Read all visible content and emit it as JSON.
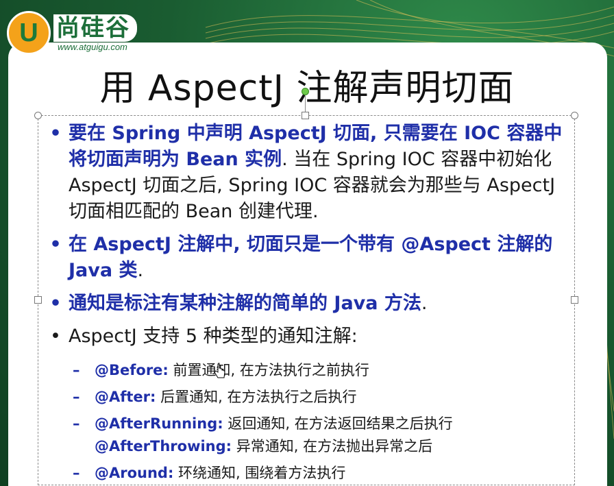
{
  "logo": {
    "badge_letter": "U",
    "name": "尚硅谷",
    "url": "www.atguigu.com",
    "brand_color": "#1d6f3a",
    "badge_color": "#f4a21a"
  },
  "title": "用 AspectJ 注解声明切面",
  "bullets": [
    {
      "dot": "•",
      "blue_text": "要在 Spring 中声明 AspectJ 切面, 只需要在 IOC 容器中将切面声明为 Bean 实例",
      "plain_text": ". 当在 Spring IOC 容器中初始化 AspectJ 切面之后, Spring IOC 容器就会为那些与 AspectJ 切面相匹配的 Bean 创建代理."
    },
    {
      "dot": "•",
      "blue_text": "在 AspectJ 注解中, 切面只是一个带有 @Aspect 注解的 Java 类",
      "plain_text": "."
    },
    {
      "dot": "•",
      "blue_text": "通知是标注有某种注解的简单的 Java 方法",
      "plain_text": "."
    },
    {
      "dot": "•",
      "blue_text": "",
      "plain_text": "AspectJ 支持 5 种类型的通知注解:"
    }
  ],
  "sub_items": [
    {
      "dash": "–",
      "label": "@Before:",
      "text": " 前置通知, 在方法执行之前执行"
    },
    {
      "dash": "–",
      "label": "@After:",
      "text": " 后置通知, 在方法执行之后执行"
    },
    {
      "dash": "–",
      "label": "@AfterRunning:",
      "text": " 返回通知, 在方法返回结果之后执行"
    },
    {
      "dash": "",
      "label": "@AfterThrowing:",
      "text": " 异常通知, 在方法抛出异常之后"
    },
    {
      "dash": "–",
      "label": "@Around:",
      "text": " 环绕通知, 围绕着方法执行"
    }
  ],
  "colors": {
    "accent_blue": "#1f2fa8",
    "text": "#1a1a1a",
    "background_green": "#1f6b3a",
    "slide_bg": "#ffffff"
  }
}
